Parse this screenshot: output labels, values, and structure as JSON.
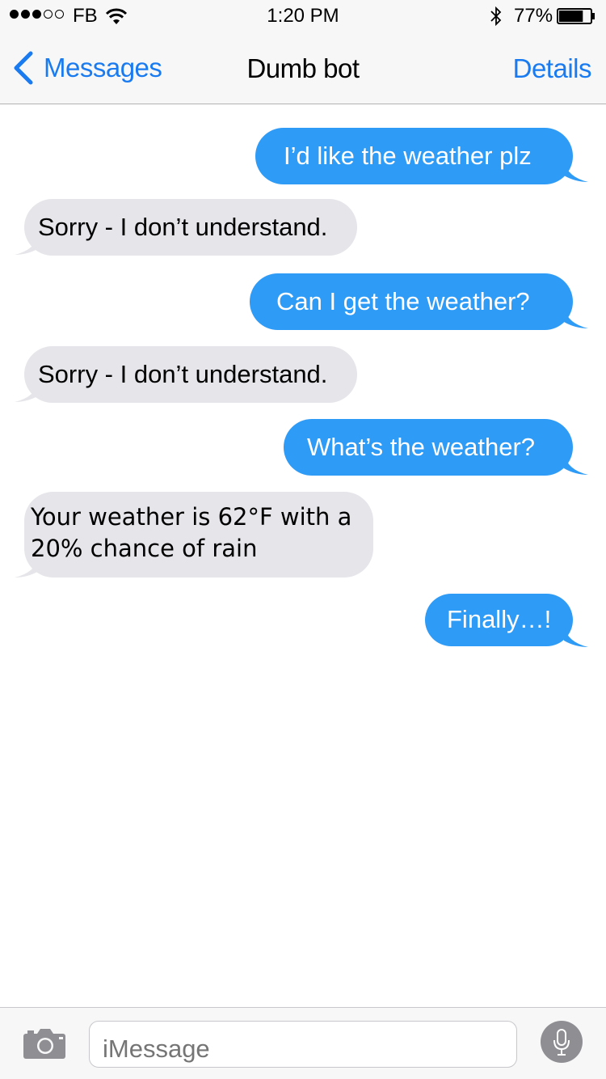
{
  "status_bar": {
    "carrier": "FB",
    "time": "1:20 PM",
    "battery_percent": "77%",
    "battery_level": 0.77,
    "signal_bars_filled": 3,
    "signal_bars_total": 5
  },
  "nav": {
    "back_label": "Messages",
    "title": "Dumb bot",
    "details_label": "Details"
  },
  "messages": [
    {
      "direction": "outgoing",
      "text": "I’d like the weather plz"
    },
    {
      "direction": "incoming",
      "text": "Sorry - I don’t understand."
    },
    {
      "direction": "outgoing",
      "text": "Can I get the weather?"
    },
    {
      "direction": "incoming",
      "text": "Sorry - I don’t understand."
    },
    {
      "direction": "outgoing",
      "text": "What’s the weather?"
    },
    {
      "direction": "incoming",
      "text_line1": "Your weather is 62°F with a",
      "text_line2": "20% chance of rain"
    },
    {
      "direction": "outgoing",
      "text": "Finally…!"
    }
  ],
  "composer": {
    "placeholder": "iMessage"
  },
  "colors": {
    "accent": "#1a7bf0",
    "outgoing_bubble": "#2e9bf7",
    "incoming_bubble": "#e5e5ea"
  },
  "icons": {
    "back": "chevron-left-icon",
    "camera": "camera-icon",
    "mic": "microphone-icon",
    "wifi": "wifi-icon",
    "bluetooth": "bluetooth-icon",
    "battery": "battery-icon"
  }
}
